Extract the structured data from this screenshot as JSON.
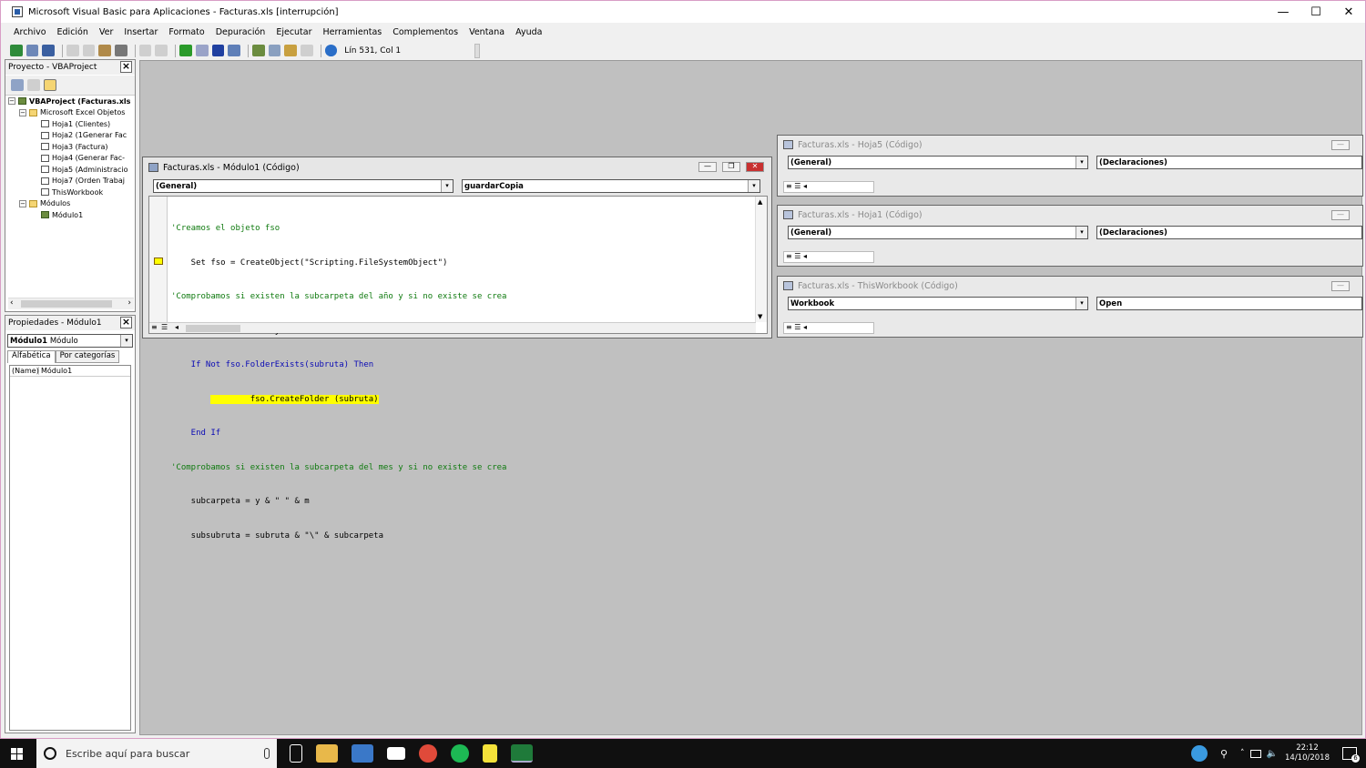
{
  "window": {
    "title": "Microsoft Visual Basic para Aplicaciones - Facturas.xls [interrupción]",
    "minimize": "—",
    "maximize": "☐",
    "close": "✕"
  },
  "menu": [
    "Archivo",
    "Edición",
    "Ver",
    "Insertar",
    "Formato",
    "Depuración",
    "Ejecutar",
    "Herramientas",
    "Complementos",
    "Ventana",
    "Ayuda"
  ],
  "toolbar": {
    "position": "Lín 531, Col 1"
  },
  "project": {
    "title": "Proyecto - VBAProject",
    "root": "VBAProject (Facturas.xls",
    "excel_objects": "Microsoft Excel Objetos",
    "sheets": [
      "Hoja1 (Clientes)",
      "Hoja2 (1Generar Fac",
      "Hoja3 (Factura)",
      "Hoja4 (Generar Fac-",
      "Hoja5 (Administracio",
      "Hoja7 (Orden Trabaj",
      "ThisWorkbook"
    ],
    "modules_folder": "Módulos",
    "module": "Módulo1"
  },
  "properties": {
    "title": "Propiedades - Módulo1",
    "object_name": "Módulo1",
    "object_type": "Módulo",
    "tab_alpha": "Alfabética",
    "tab_cat": "Por categorías",
    "row_name": "(Name)",
    "row_value": "Módulo1"
  },
  "main_code": {
    "title": "Facturas.xls - Módulo1 (Código)",
    "left_dd": "(General)",
    "right_dd": "guardarCopia",
    "lines": [
      {
        "text": "'Creamos el objeto fso",
        "cls": "cm"
      },
      {
        "text": "    Set fso = CreateObject(\"Scripting.FileSystemObject\")",
        "cls": ""
      },
      {
        "text": "'Comprobamos si existen la subcarpeta del año y si no existe se crea",
        "cls": "cm"
      },
      {
        "text": "    subruta = ruta & y",
        "cls": ""
      },
      {
        "text": "    If Not fso.FolderExists(subruta) Then",
        "cls": ""
      },
      {
        "text": "        fso.CreateFolder (subruta)",
        "cls": "hl"
      },
      {
        "text": "    End If",
        "cls": "kw"
      },
      {
        "text": "'Comprobamos si existen la subcarpeta del mes y si no existe se crea",
        "cls": "cm"
      },
      {
        "text": "    subcarpeta = y & \" \" & m",
        "cls": ""
      },
      {
        "text": "    subsubruta = subruta & \"\\\" & subcarpeta",
        "cls": ""
      }
    ]
  },
  "side_windows": [
    {
      "title": "Facturas.xls - Hoja5 (Código)",
      "left_dd": "(General)",
      "right_dd": "(Declaraciones)"
    },
    {
      "title": "Facturas.xls - Hoja1 (Código)",
      "left_dd": "(General)",
      "right_dd": "(Declaraciones)"
    },
    {
      "title": "Facturas.xls - ThisWorkbook (Código)",
      "left_dd": "Workbook",
      "right_dd": "Open"
    }
  ],
  "taskbar": {
    "search_placeholder": "Escribe aquí para buscar",
    "time": "22:12",
    "date": "14/10/2018",
    "notif": "6"
  },
  "colors": {
    "comment": "#0f7a0f",
    "keyword": "#0a0ab4",
    "highlight": "#ffff00",
    "workspace": "#c0c0c0",
    "taskbar": "#101010"
  }
}
